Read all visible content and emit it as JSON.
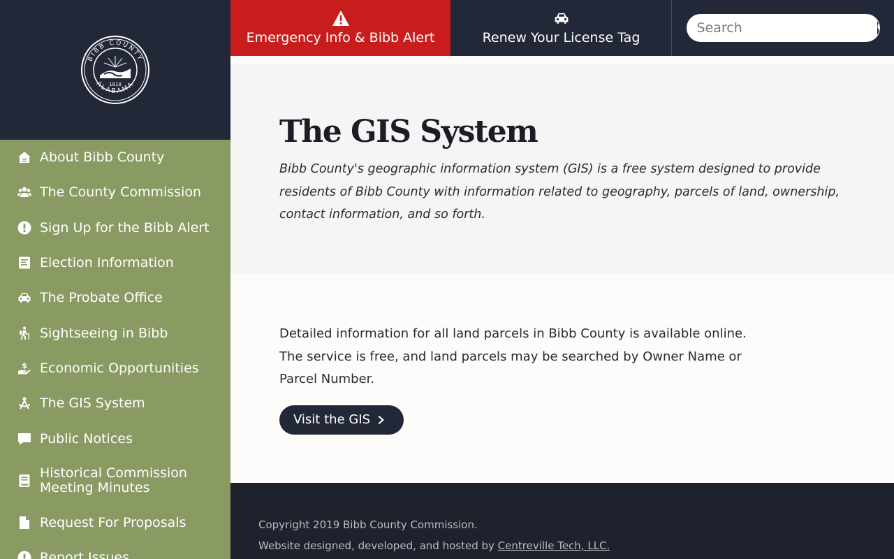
{
  "sidebar": {
    "seal_text": {
      "top": "BIBB COUNTY",
      "bottom": "ALABAMA",
      "year": "1818"
    },
    "items": [
      {
        "label": "About Bibb County",
        "icon": "cabin-icon"
      },
      {
        "label": "The County Commission",
        "icon": "users-icon"
      },
      {
        "label": "Sign Up for the Bibb Alert",
        "icon": "exclamation-circle-icon"
      },
      {
        "label": "Election Information",
        "icon": "ballot-icon"
      },
      {
        "label": "The Probate Office",
        "icon": "car-icon"
      },
      {
        "label": "Sightseeing in Bibb",
        "icon": "hiking-icon"
      },
      {
        "label": "Economic Opportunities",
        "icon": "hand-holding-dollar-icon"
      },
      {
        "label": "The GIS System",
        "icon": "drafting-compass-icon"
      },
      {
        "label": "Public Notices",
        "icon": "comment-icon"
      },
      {
        "label": "Historical Commission Meeting Minutes",
        "icon": "book-icon"
      },
      {
        "label": "Request For Proposals",
        "icon": "file-icon"
      },
      {
        "label": "Report Issues",
        "icon": "exclamation-circle-icon"
      }
    ]
  },
  "topbar": {
    "emergency_label": "Emergency Info & Bibb Alert",
    "license_label": "Renew Your License Tag",
    "search_placeholder": "Search"
  },
  "hero": {
    "title": "The GIS System",
    "intro": "Bibb County's geographic information system (GIS) is a free system designed to provide residents of Bibb County with information related to geography, parcels of land, ownership, contact information, and so forth."
  },
  "main": {
    "text": "Detailed information for all land parcels in Bibb County is available online. The service is free, and land parcels may be searched by Owner Name or Parcel Number.",
    "button_label": "Visit the GIS"
  },
  "footer": {
    "copyright": "Copyright 2019 Bibb County Commission.",
    "credit_prefix": "Website designed, developed, and hosted by ",
    "credit_link": "Centreville Tech, LLC."
  },
  "colors": {
    "navy": "#222838",
    "sidebar_green": "#8a9a63",
    "emergency_red": "#c91c1c",
    "footer_bg": "#1e222d"
  }
}
